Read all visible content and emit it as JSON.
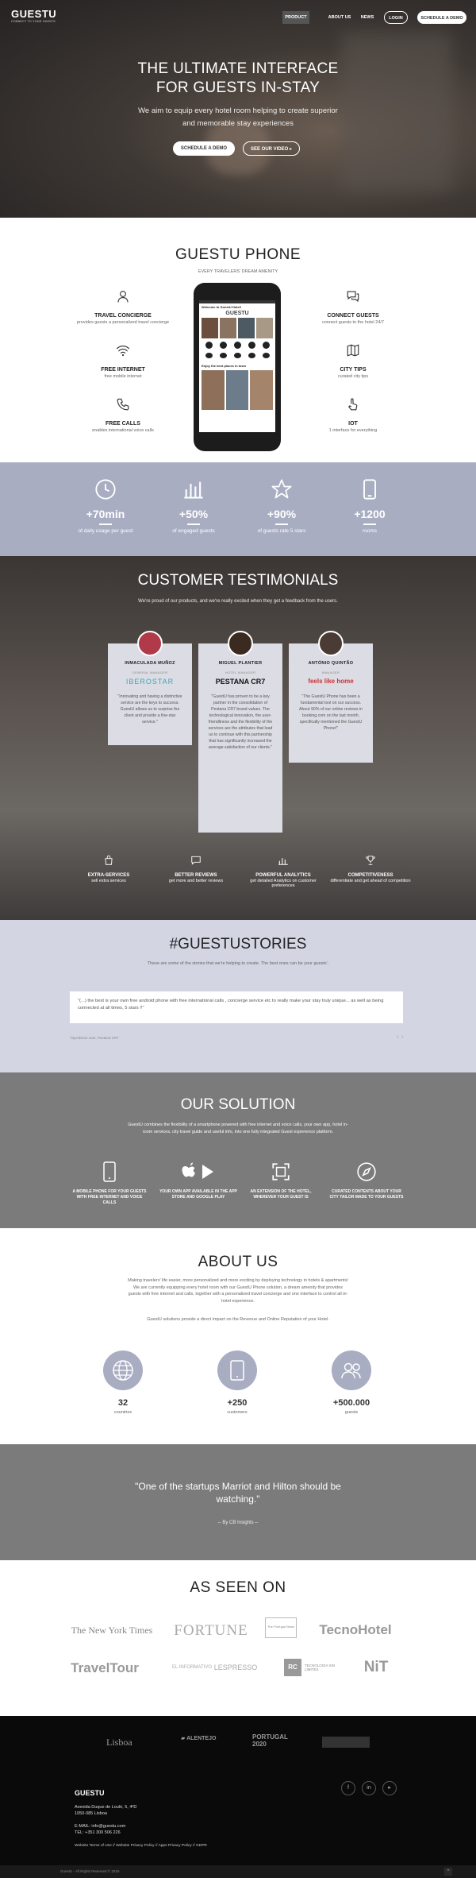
{
  "nav": {
    "logo": "GUESTU",
    "tagline": "CONNECT TO YOUR GUESTS",
    "items": [
      "PRODUCT",
      "ABOUT US",
      "NEWS"
    ],
    "login": "LOGIN",
    "schedule": "SCHEDULE A DEMO"
  },
  "hero": {
    "title_line1": "THE ULTIMATE INTERFACE",
    "title_line2": "FOR GUESTS IN-STAY",
    "sub_line1": "We aim to equip every hotel room helping to create superior",
    "sub_line2": "and memorable stay experiences",
    "btn_demo": "SCHEDULE A DEMO",
    "btn_video": "SEE OUR VIDEO"
  },
  "phone_section": {
    "title": "GUESTU PHONE",
    "subtitle": "EVERY TRAVELERS' DREAM AMENITY",
    "features_left": [
      {
        "title": "TRAVEL CONCIERGE",
        "desc": "provides guests a personalized travel concierge",
        "icon": "user-icon"
      },
      {
        "title": "FREE INTERNET",
        "desc": "free mobile internet",
        "icon": "wifi-icon"
      },
      {
        "title": "FREE CALLS",
        "desc": "enables international voice calls",
        "icon": "phone-icon"
      }
    ],
    "features_right": [
      {
        "title": "CONNECT GUESTS",
        "desc": "connect guests to the hotel 24/7",
        "icon": "chat-icon"
      },
      {
        "title": "CITY TIPS",
        "desc": "curated city tips",
        "icon": "map-icon"
      },
      {
        "title": "IOT",
        "desc": "1 interface for everything",
        "icon": "touch-icon"
      }
    ],
    "screen": {
      "header": "Welcome to GuestU Hotel!",
      "logo": "GUESTU",
      "section": "Enjoy the best places in town"
    }
  },
  "stats": [
    {
      "num": "+70min",
      "label": "of daily usage per guest",
      "icon": "clock-icon"
    },
    {
      "num": "+50%",
      "label": "of engaged guests",
      "icon": "bar-chart-icon"
    },
    {
      "num": "+90%",
      "label": "of guests rate 5 stars",
      "icon": "star-icon"
    },
    {
      "num": "+1200",
      "label": "rooms",
      "icon": "mobile-icon"
    }
  ],
  "testimonials": {
    "title": "CUSTOMER TESTIMONIALS",
    "subtitle": "We're proud of our products, and we're really excited when they get a feedback from the users.",
    "cards": [
      {
        "name": "INMACULADA MUÑOZ",
        "role": "GENERAL MANAGER",
        "brand": "IBEROSTAR",
        "quote": "\"Innovating and having a distinctive service are the keys to success. GuestU allows us to surprise the client and provide a five-star service.\""
      },
      {
        "name": "MIGUEL PLANTIER",
        "role": "HOTEL MANAGER",
        "brand": "PESTANA CR7",
        "quote": "\"GuestU has proven to be a key partner in the consolidation of Pestana CR7 brand values. The technological innovation, the user-friendliness and the flexibility of the services are the attributes that lead us to continue with this partnership that has significantly increased the average satisfaction of our clients.\""
      },
      {
        "name": "ANTÓNIO QUINTÃO",
        "role": "MANAGER",
        "brand": "feels like home",
        "quote": "\"The GuestU Phone has been a fundamental tool on our success. About 90% of our online reviews in booking.com on the last month, specifically mentioned the GuestU Phone!\""
      }
    ],
    "advantages": [
      {
        "title": "EXTRA-SERVICES",
        "desc": "sell extra services",
        "icon": "bag-icon"
      },
      {
        "title": "BETTER REVIEWS",
        "desc": "get more and better reviews",
        "icon": "comment-icon"
      },
      {
        "title": "POWERFUL ANALYTICS",
        "desc": "get detailed Analytics on customer preferences",
        "icon": "analytics-icon"
      },
      {
        "title": "COMPETITIVENESS",
        "desc": "differentiate and get ahead of competition",
        "icon": "trophy-icon"
      }
    ]
  },
  "stories": {
    "title": "#GUESTUSTORIES",
    "subtitle": "These are some of the stories that we're helping to create. The best ones can be your guests'.",
    "text": "\"(...) the best is your own free android phone with free international calls , concierge service etc to really make your stay truly unique... as well as being connected at all times, 5 stars !!\"",
    "source": "TripAdvisor user, Pestana CR7"
  },
  "solution": {
    "title": "OUR SOLUTION",
    "text": "GuestU combines the flexibility of a smartphone powered with free internet and voice calls, your own app, hotel in-room services, city travel guide and useful info, into one fully integrated Guest experience platform.",
    "items": [
      {
        "label": "A MOBILE PHONE FOR YOUR GUESTS WITH FREE INTERNET AND VOICE CALLS",
        "icon": "mobile-icon"
      },
      {
        "label": "YOUR OWN APP AVAILABLE IN THE APP STORE AND GOOGLE PLAY",
        "icon": "apple-play-icon"
      },
      {
        "label": "AN EXTENSION OF THE HOTEL, WHEREVER YOUR GUEST IS",
        "icon": "expand-icon"
      },
      {
        "label": "CURATED CONTENTS ABOUT YOUR CITY TAILOR MADE TO YOUR GUESTS",
        "icon": "compass-icon"
      }
    ]
  },
  "about": {
    "title": "ABOUT US",
    "text1": "Making travelers' life easier, more personalized and more exciting by deploying technology in hotels & apartments! We are currently equipping every hotel room with our GuestU Phone solution, a dream amenity that provides guests with free internet and calls, together with a personalized travel concierge and one interface to control all in-hotel experience.",
    "text2": "GuestU solutions provide a direct impact on the Revenue and Online Reputation of your Hotel.",
    "stats": [
      {
        "num": "32",
        "label": "countries",
        "icon": "globe-icon"
      },
      {
        "num": "+250",
        "label": "customers",
        "icon": "tablet-icon"
      },
      {
        "num": "+500.000",
        "label": "guests",
        "icon": "users-icon"
      }
    ]
  },
  "quote": {
    "line1": "\"One of the startups Marriot and Hilton should be",
    "line2": "watching.\"",
    "source": "-- By CB Insights --"
  },
  "press": {
    "title": "AS SEEN ON",
    "row1": [
      "The New York Times",
      "FORTUNE",
      "The Portugal News",
      "TecnoHotel"
    ],
    "row2": [
      "TravelTour",
      "EL INFORMATIVO",
      "LESPRESSO",
      "RC",
      "TECNOLOGÍA SIN LÍMITES",
      "NiT"
    ]
  },
  "footer": {
    "partners": [
      "Lisboa",
      "ALENTEJO",
      "PORTUGAL 2020"
    ],
    "logo": "GUESTU",
    "address1": "Avenida Duque de Loulé, 5, 4ºD",
    "address2": "1050-085 Lisboa",
    "email": "E-MAIL: info@guestu.com",
    "tel": "TEL: +351 300 506 226",
    "links": "Website Terms of Use // Website Privacy Policy // Apps Privacy Policy // GDPR",
    "copyright": "GuestU - All Rights Reserved © 2019"
  }
}
